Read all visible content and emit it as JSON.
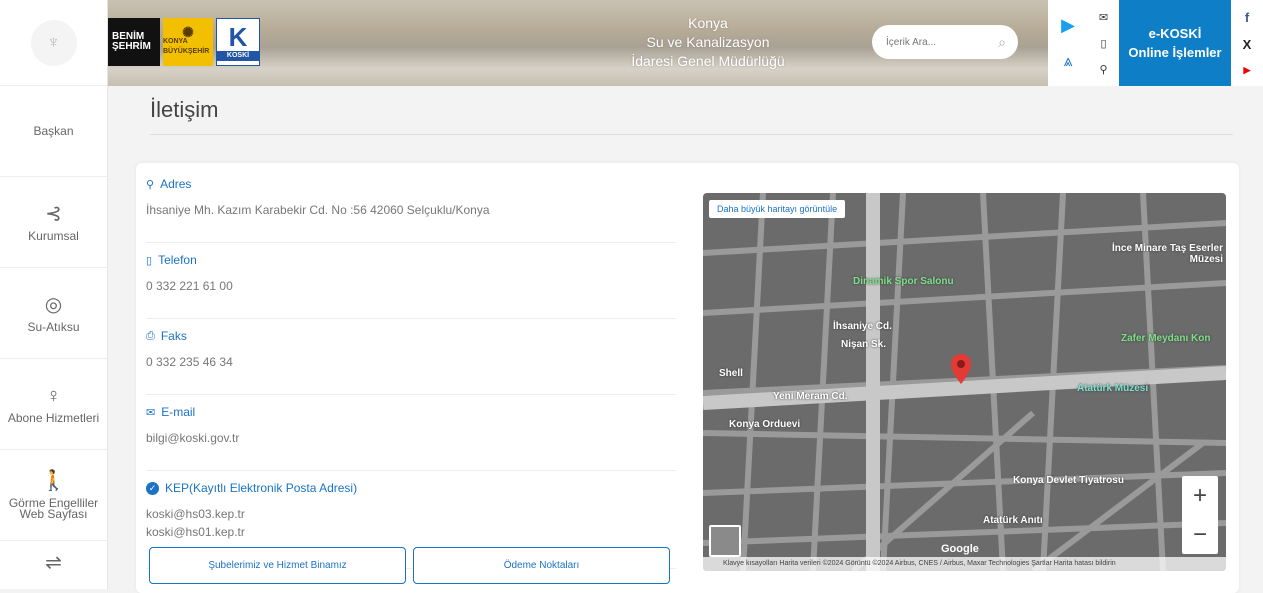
{
  "sidebar": {
    "items": [
      {
        "label": "Başkan",
        "icon": "person-icon"
      },
      {
        "label": "Kurumsal",
        "icon": "share-icon"
      },
      {
        "label": "Su-Atıksu",
        "icon": "water-drop-icon"
      },
      {
        "label": "Abone Hizmetleri",
        "icon": "user-icon"
      },
      {
        "label": "Görme Engelliler Web Sayfası",
        "icon": "accessibility-icon"
      },
      {
        "label": "",
        "icon": "menu-icon"
      }
    ]
  },
  "header": {
    "logo1": "BENİM ŞEHRİM",
    "logo2": "KONYA BÜYÜKŞEHİR",
    "logo3_letter": "K",
    "logo3_text": "KOSKİ",
    "title_line1": "Konya",
    "title_line2": "Su ve Kanalizasyon",
    "title_line3": "İdaresi Genel Müdürlüğü",
    "search_placeholder": "İçerik Ara...",
    "ekoski_line1": "e-KOSKİ",
    "ekoski_line2": "Online İşlemler",
    "social": [
      "f",
      "X",
      "▶"
    ]
  },
  "page": {
    "title": "İletişim"
  },
  "contact": {
    "address_label": "Adres",
    "address_value": "İhsaniye Mh. Kazım Karabekir Cd. No :56 42060 Selçuklu/Konya",
    "phone_label": "Telefon",
    "phone_value": "0 332 221 61 00",
    "fax_label": "Faks",
    "fax_value": "0 332 235 46 34",
    "email_label": "E-mail",
    "email_value": "bilgi@koski.gov.tr",
    "kep_label": "KEP(Kayıtlı Elektronik Posta Adresi)",
    "kep_value1": "koski@hs03.kep.tr",
    "kep_value2": "koski@hs01.kep.tr"
  },
  "buttons": {
    "branches": "Şubelerimiz ve Hizmet Binamız",
    "payment": "Ödeme Noktaları"
  },
  "map": {
    "larger_map": "Daha büyük haritayı görüntüle",
    "labels": [
      "Dinamik Spor Salonu",
      "İhsaniye Cd.",
      "Nişan Sk.",
      "Shell",
      "Yeni Meram Cd.",
      "Konya Orduevi",
      "Atatürk Müzesi",
      "Konya Devlet Tiyatrosu",
      "Atatürk Anıtı",
      "Zafer Meydanı Kon",
      "İnce Minare Taş Eserler Müzesi"
    ],
    "footer": "Klavye kısayolları   Harita verileri ©2024 Görüntü ©2024 Airbus, CNES / Airbus, Maxar Technologies   Şartlar   Harita hatası bildirin",
    "google": "Google",
    "zoom_in": "+",
    "zoom_out": "−"
  }
}
